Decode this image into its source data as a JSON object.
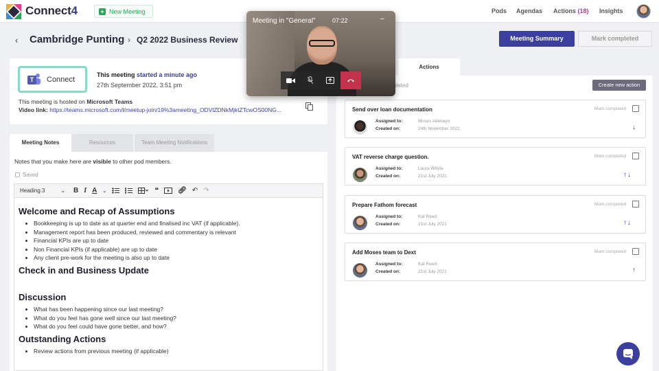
{
  "app": {
    "name_main": "Connect",
    "name_num": "4"
  },
  "topbar": {
    "new_meeting": "New Meeting",
    "nav": {
      "pods": "Pods",
      "agendas": "Agendas",
      "actions": "Actions",
      "actions_count": "(18)",
      "insights": "Insights"
    }
  },
  "header": {
    "back": "‹",
    "pod": "Cambridge Punting",
    "sep": "›",
    "meeting": "Q2 2022 Business Review",
    "summary_btn": "Meeting Summary",
    "complete_btn": "Mark completed"
  },
  "info": {
    "connect_label": "Connect",
    "teams_letter": "T",
    "started_prefix": "This meeting",
    "started_rel": "started a minute ago",
    "started_date": "27th September 2022, 3:51 pm",
    "hosted_prefix": "This meeting is hosted on",
    "hosted_platform": "Microsoft Teams",
    "video_label": "Video link:",
    "video_url": "https://teams.microsoft.com/l/meetup-join/19%3ameeting_ODVlZDNkMjktZTcwOS00NG..."
  },
  "tabs": [
    {
      "label": "Meeting Notes"
    },
    {
      "label": "Resources"
    },
    {
      "label": "Team Meeting Notifications"
    }
  ],
  "notes": {
    "hint_pre": "Notes that you make here are",
    "hint_bold": "visible",
    "hint_post": "to other pod members.",
    "saved": "Saved",
    "toolbar": {
      "heading": "Heading 3",
      "chev": "⌄"
    },
    "sections": [
      {
        "heading": "Welcome and Recap of Assumptions",
        "items": [
          "Bookkeeping is up to date as at quarter end and finalised inc VAT (if applicable).",
          "Management report has been produced, reviewed and commentary is relevant",
          "Financial KPIs are up to date",
          "Non Financial KPIs (if applicable) are up to date",
          "Any client pre-work for the meeting is also up to date"
        ]
      },
      {
        "heading": "Check in and Business Update",
        "items": []
      },
      {
        "heading": "Discussion",
        "items": [
          "What has been happening since our last meeting?",
          "What do you feel has gone well since our last meeting?",
          "What do you feel could have gone better, and how?"
        ]
      },
      {
        "heading": "Outstanding Actions",
        "items": [
          "Review actions from previous meeting (if applicable)"
        ]
      }
    ]
  },
  "actions": {
    "tab": "Actions",
    "completed_label": "ompleted",
    "create_btn": "Create new action",
    "mark_label": "Mark completed",
    "assigned_label": "Assigned to:",
    "created_label": "Created on:",
    "items": [
      {
        "title": "Send over loan documentation",
        "assignee": "Moses Adebayo",
        "created": "24th November 2021",
        "arrows": "↓"
      },
      {
        "title": "VAT reverse charge question.",
        "assignee": "Laura Whyte",
        "created": "21st July 2021",
        "arrows": "↑↓"
      },
      {
        "title": "Prepare Fathom forecast",
        "assignee": "Kat Reed",
        "created": "21st July 2021",
        "arrows": "↑↓"
      },
      {
        "title": "Add Moses team to Dext",
        "assignee": "Kat Reed",
        "created": "21st July 2021",
        "arrows": "↑"
      }
    ]
  },
  "video": {
    "title": "Meeting in \"General\"",
    "time": "07:22",
    "minimize": "–"
  },
  "colors": {
    "accent": "#3b3f9d",
    "teams": "#5558af",
    "end_call": "#c4314b",
    "success": "#2ea35a"
  }
}
